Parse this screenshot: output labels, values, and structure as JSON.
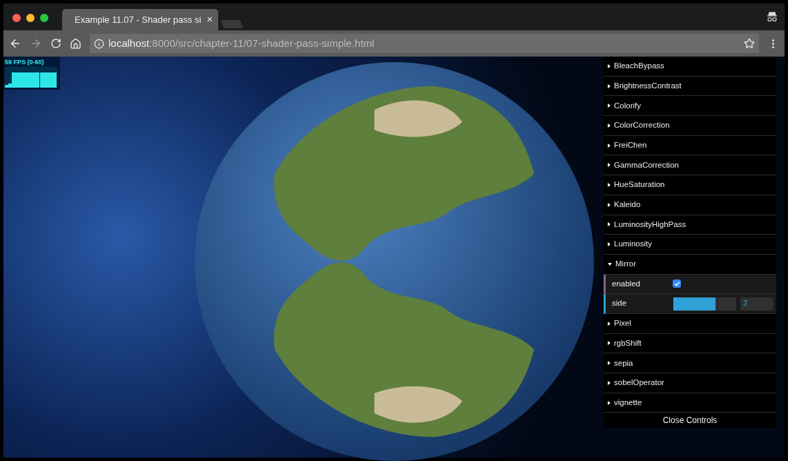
{
  "tab": {
    "title": "Example 11.07 - Shader pass si",
    "close": "×"
  },
  "address": {
    "host": "localhost",
    "path": ":8000/src/chapter-11/07-shader-pass-simple.html"
  },
  "stats": {
    "label": "59 FPS (0-60)"
  },
  "controls": {
    "folders": [
      {
        "name": "BleachBypass",
        "expanded": false
      },
      {
        "name": "BrightnessContrast",
        "expanded": false
      },
      {
        "name": "Colorify",
        "expanded": false
      },
      {
        "name": "ColorCorrection",
        "expanded": false
      },
      {
        "name": "FreiChen",
        "expanded": false
      },
      {
        "name": "GammaCorrection",
        "expanded": false
      },
      {
        "name": "HueSaturation",
        "expanded": false
      },
      {
        "name": "Kaleido",
        "expanded": false
      },
      {
        "name": "LuminosityHighPass",
        "expanded": false
      },
      {
        "name": "Luminosity",
        "expanded": false
      },
      {
        "name": "Mirror",
        "expanded": true,
        "items": [
          {
            "kind": "checkbox",
            "label": "enabled",
            "checked": true
          },
          {
            "kind": "slider",
            "label": "side",
            "level": 0.67,
            "value": "2"
          }
        ]
      },
      {
        "name": "Pixel",
        "expanded": false
      },
      {
        "name": "rgbShift",
        "expanded": false
      },
      {
        "name": "sepia",
        "expanded": false
      },
      {
        "name": "sobelOperator",
        "expanded": false
      },
      {
        "name": "vignette",
        "expanded": false
      }
    ],
    "close_button": "Close Controls"
  }
}
